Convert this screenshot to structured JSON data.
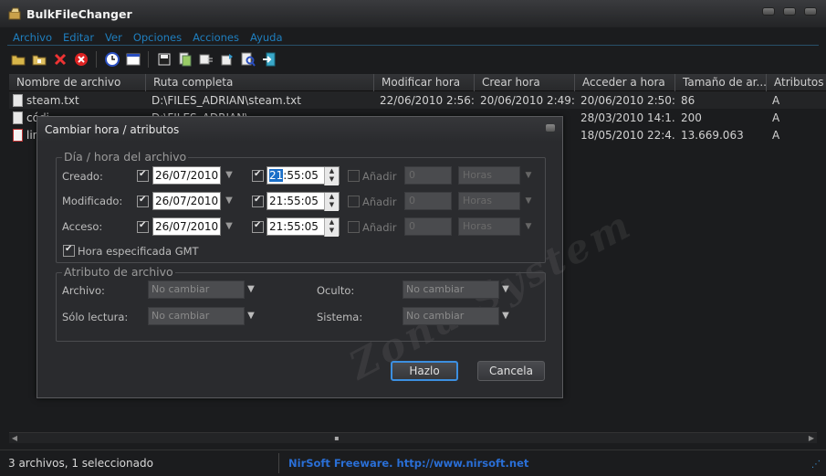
{
  "window": {
    "title": "BulkFileChanger"
  },
  "menu": [
    "Archivo",
    "Editar",
    "Ver",
    "Opciones",
    "Acciones",
    "Ayuda"
  ],
  "toolbar_icons": [
    "folder-open-icon",
    "folder-add-icon",
    "delete-icon",
    "stop-icon",
    "clock-icon",
    "window-icon",
    "save-icon",
    "copy-icon",
    "properties-icon",
    "refresh-icon",
    "search-icon",
    "exit-icon"
  ],
  "columns": [
    "Nombre de archivo",
    "Ruta completa",
    "Modificar hora",
    "Crear hora",
    "Acceder a hora",
    "Tamaño de ar...",
    "Atributos"
  ],
  "rows": [
    {
      "name": "steam.txt",
      "path": "D:\\FILES_ADRIAN\\steam.txt",
      "modified": "22/06/2010 2:56:...",
      "created": "20/06/2010 2:49:...",
      "accessed": "20/06/2010 2:50:...",
      "size": "86",
      "attr": "A"
    },
    {
      "name": "códi...",
      "path": "D:\\FILES_ADRIAN\\...",
      "modified": "",
      "created": "",
      "accessed": "28/03/2010 14:1...",
      "size": "200",
      "attr": "A"
    },
    {
      "name": "lin...",
      "path": "",
      "modified": "",
      "created": "",
      "accessed": "18/05/2010 22:4...",
      "size": "13.669.063",
      "attr": "A"
    }
  ],
  "status": {
    "count": "3 archivos, 1 seleccionado",
    "link": "NirSoft Freeware.  http://www.nirsoft.net"
  },
  "dialog": {
    "title": "Cambiar hora / atributos",
    "time_group": "Día / hora del archivo",
    "rows": [
      {
        "label": "Creado:",
        "date": "26/07/2010",
        "time_sel": "21",
        "time_rest": ":55:05",
        "add": "Añadir"
      },
      {
        "label": "Modificado:",
        "date": "26/07/2010",
        "time_sel": "",
        "time_rest": "21:55:05",
        "add": "Añadir"
      },
      {
        "label": "Acceso:",
        "date": "26/07/2010",
        "time_sel": "",
        "time_rest": "21:55:05",
        "add": "Añadir"
      }
    ],
    "add_value": "0",
    "add_unit": "Horas",
    "gmt_label": "Hora especificada GMT",
    "attr_group": "Atributo de archivo",
    "attrs": [
      {
        "label": "Archivo:",
        "value": "No cambiar"
      },
      {
        "label": "Oculto:",
        "value": "No cambiar"
      },
      {
        "label": "Sólo lectura:",
        "value": "No cambiar"
      },
      {
        "label": "Sistema:",
        "value": "No cambiar"
      }
    ],
    "ok": "Hazlo",
    "cancel": "Cancela"
  },
  "watermark": "Zona System"
}
